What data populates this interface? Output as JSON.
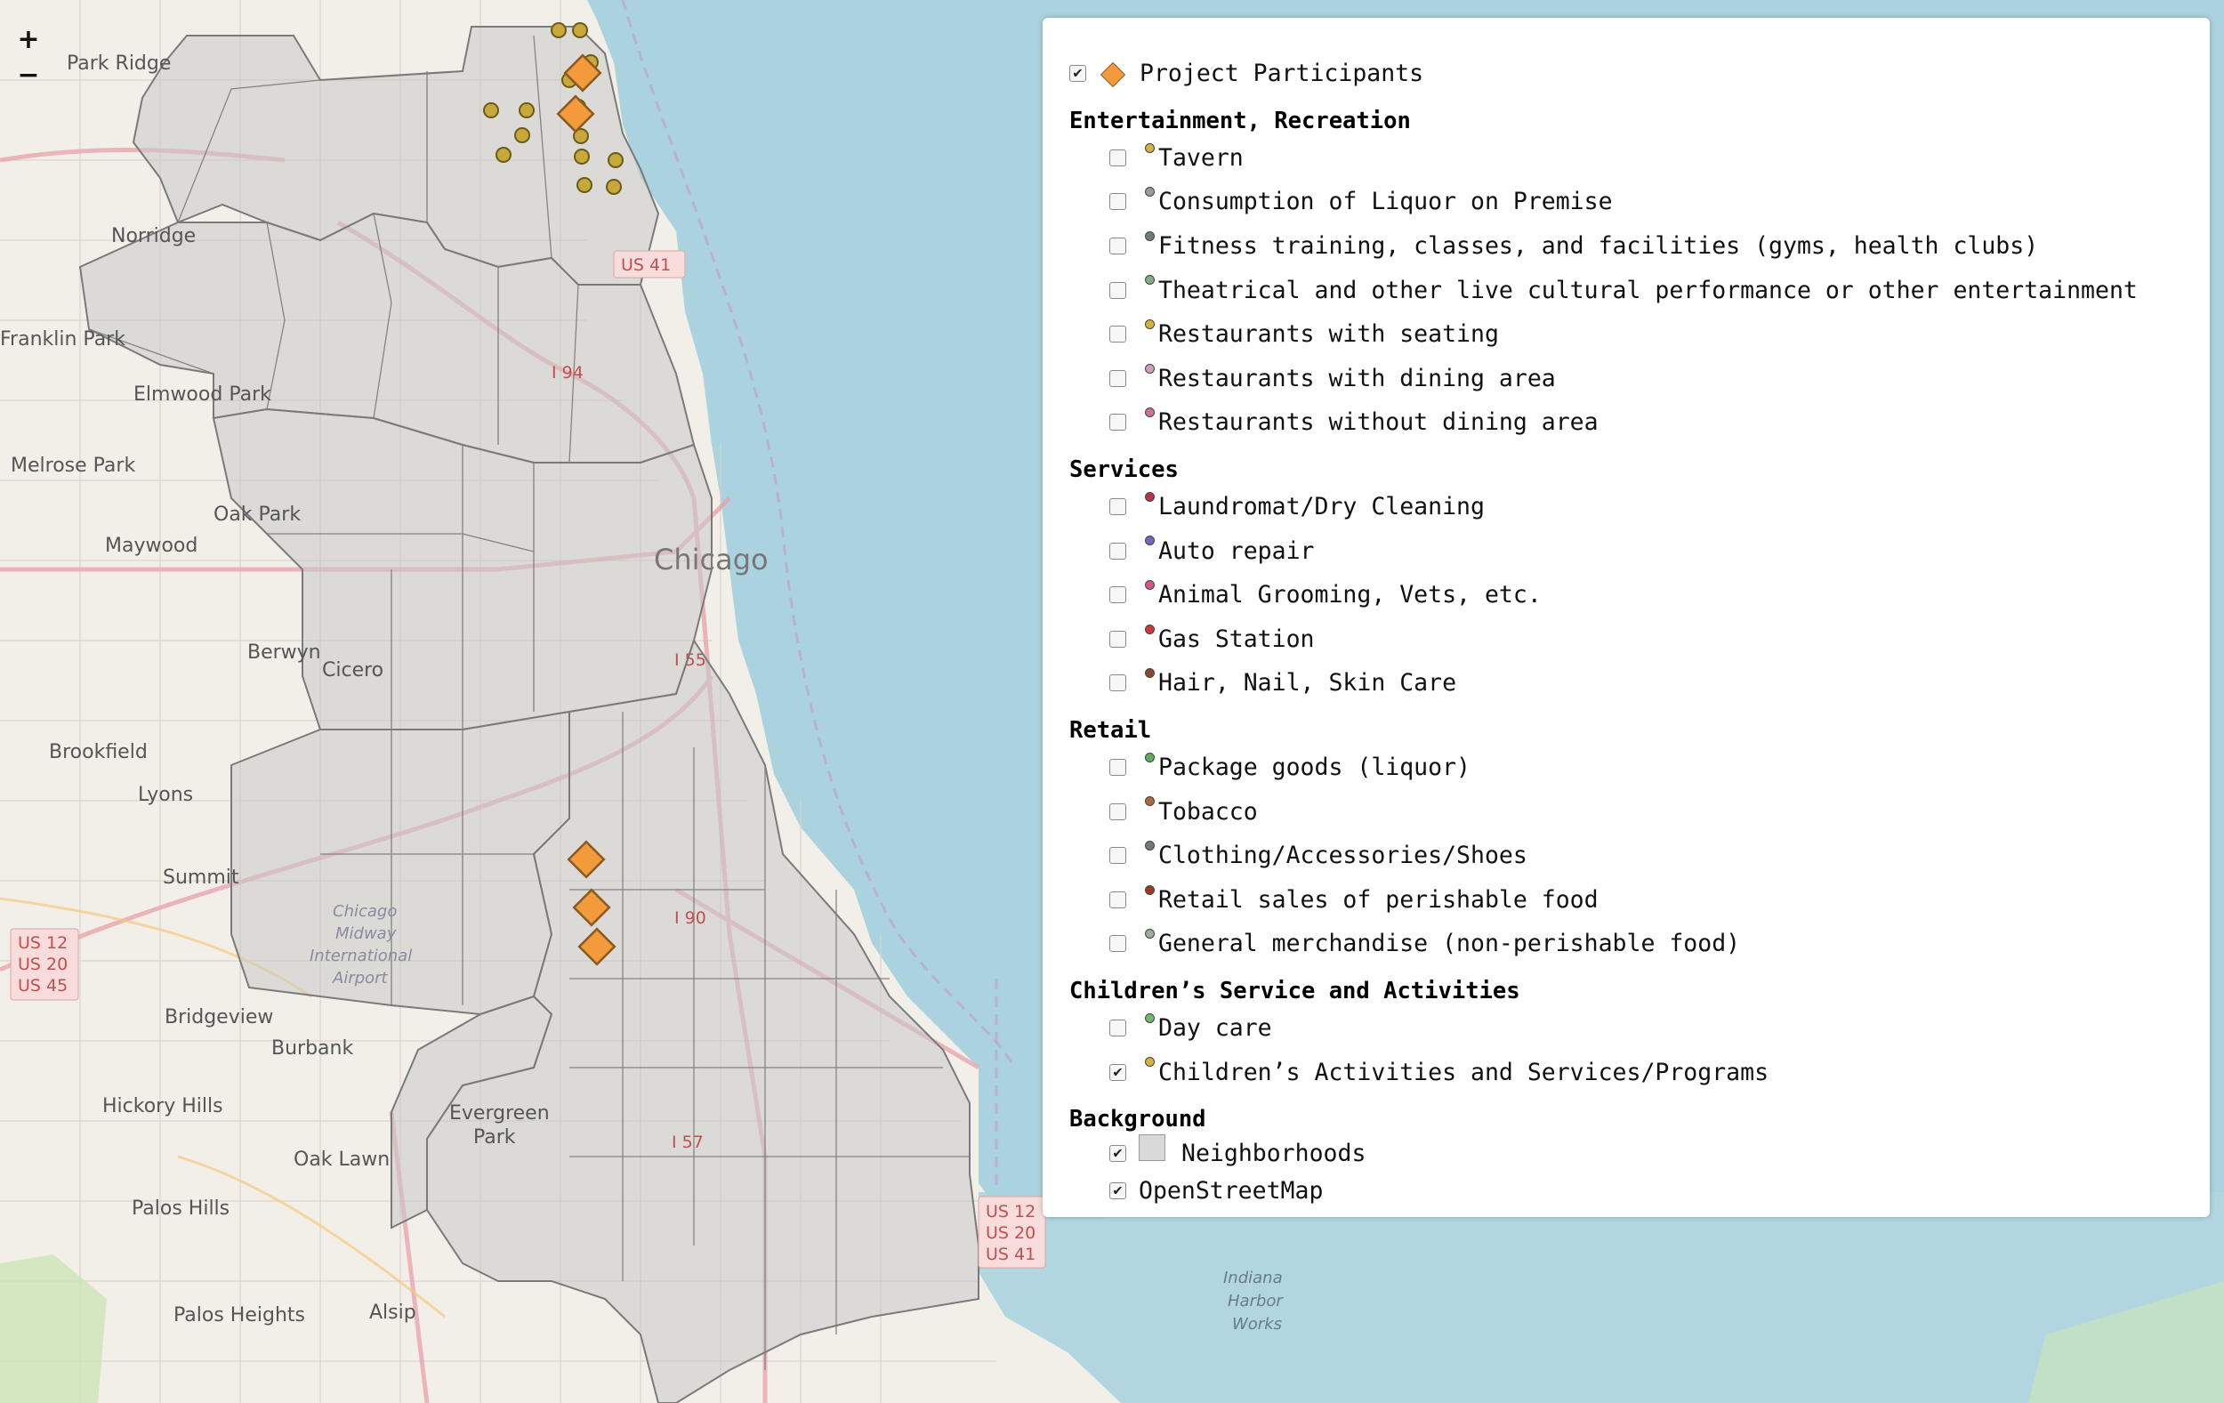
{
  "map": {
    "zoom_in": "+",
    "zoom_out": "−",
    "water_color": "#aad3df",
    "land_color": "#f2efe9",
    "neighborhood_fill": "#c8c8c8",
    "labels": [
      {
        "text": "Park Ridge"
      },
      {
        "text": "Norridge"
      },
      {
        "text": "Franklin Park"
      },
      {
        "text": "Elmwood Park"
      },
      {
        "text": "Melrose Park"
      },
      {
        "text": "Oak Park"
      },
      {
        "text": "Maywood"
      },
      {
        "text": "Berwyn"
      },
      {
        "text": "Cicero"
      },
      {
        "text": "Chicago"
      },
      {
        "text": "Brookfield"
      },
      {
        "text": "Lyons"
      },
      {
        "text": "Summit"
      },
      {
        "text": "Bridgeview"
      },
      {
        "text": "Burbank"
      },
      {
        "text": "Hickory Hills"
      },
      {
        "text": "Oak Lawn"
      },
      {
        "text": "Evergreen"
      },
      {
        "text": "Park"
      },
      {
        "text": "Palos Hills"
      },
      {
        "text": "Palos Heights"
      },
      {
        "text": "Alsip"
      },
      {
        "text": "Indiana"
      },
      {
        "text": "Harbor"
      },
      {
        "text": "Works"
      },
      {
        "text": "Chicago"
      },
      {
        "text": "Midway"
      },
      {
        "text": "International"
      },
      {
        "text": "Airport"
      }
    ],
    "shields": [
      "US 41",
      "US 12\nUS 20\nUS 41",
      "US 12\nUS 20\nUS 45",
      "I 94",
      "I 90",
      "I 55",
      "I 57"
    ],
    "tavern_markers_count": 14,
    "participant_markers_count": 5
  },
  "legend": {
    "participants": {
      "label": "Project Participants",
      "checked": true,
      "color": "#f39a3c"
    },
    "groups": [
      {
        "title": "Entertainment, Recreation",
        "items": [
          {
            "label": "Tavern",
            "checked": false,
            "color": "#d6b13c"
          },
          {
            "label": "Consumption of Liquor on Premise",
            "checked": false,
            "color": "#9a9a9a"
          },
          {
            "label": "Fitness training, classes, and facilities (gyms, health clubs)",
            "checked": false,
            "color": "#6f7d74"
          },
          {
            "label": "Theatrical and other live cultural performance or other entertainment",
            "checked": false,
            "color": "#7fae7f"
          },
          {
            "label": "Restaurants with seating",
            "checked": false,
            "color": "#d6b13c"
          },
          {
            "label": "Restaurants with dining area",
            "checked": false,
            "color": "#d59ac0"
          },
          {
            "label": "Restaurants without dining area",
            "checked": false,
            "color": "#cf6f9a"
          }
        ]
      },
      {
        "title": "Services",
        "items": [
          {
            "label": "Laundromat/Dry Cleaning",
            "checked": false,
            "color": "#b8334a"
          },
          {
            "label": "Auto repair",
            "checked": false,
            "color": "#7a63c4"
          },
          {
            "label": "Animal Grooming, Vets, etc.",
            "checked": false,
            "color": "#d4558a"
          },
          {
            "label": "Gas Station",
            "checked": false,
            "color": "#d03636"
          },
          {
            "label": "Hair, Nail, Skin Care",
            "checked": false,
            "color": "#8a4a32"
          }
        ]
      },
      {
        "title": "Retail",
        "items": [
          {
            "label": "Package goods (liquor)",
            "checked": false,
            "color": "#5fae5f"
          },
          {
            "label": "Tobacco",
            "checked": false,
            "color": "#a86a40"
          },
          {
            "label": "Clothing/Accessories/Shoes",
            "checked": false,
            "color": "#727a7a"
          },
          {
            "label": "Retail sales of perishable food",
            "checked": false,
            "color": "#a23a22"
          },
          {
            "label": "General merchandise (non-perishable food)",
            "checked": false,
            "color": "#9aae9a"
          }
        ]
      },
      {
        "title": "Children’s Service and Activities",
        "items": [
          {
            "label": "Day care",
            "checked": false,
            "color": "#6fb86f"
          },
          {
            "label": "Children’s Activities and Services/Programs",
            "checked": true,
            "color": "#d6b13c"
          }
        ]
      },
      {
        "title": "Background",
        "items": [
          {
            "label": "Neighborhoods",
            "checked": true,
            "swatch": true
          },
          {
            "label": "OpenStreetMap",
            "checked": true,
            "plain": true
          }
        ]
      }
    ]
  }
}
